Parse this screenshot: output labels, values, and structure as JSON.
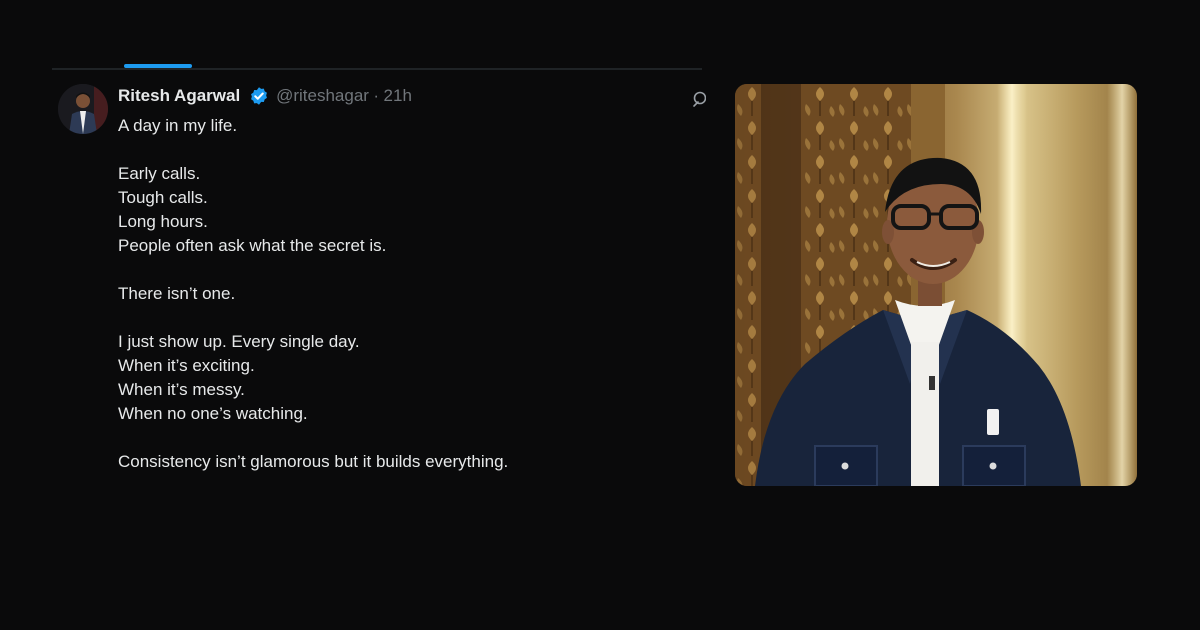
{
  "tweet": {
    "author_name": "Ritesh Agarwal",
    "handle": "@riteshagar",
    "separator": "·",
    "timestamp": "21h",
    "verified": true,
    "lines": [
      "A day in my life.",
      "",
      "Early calls.",
      "Tough calls.",
      "Long hours.",
      "People often ask what the secret is.",
      "",
      "There isn’t one.",
      "",
      "I just show up. Every single day.",
      "When it’s exciting.",
      "When it’s messy.",
      "When no one’s watching.",
      "",
      "Consistency isn’t glamorous but it builds everything."
    ]
  },
  "icons": {
    "verified": "verified-badge-icon",
    "grok": "grok-icon"
  },
  "colors": {
    "background": "#0a0a0b",
    "accent": "#1d9bf0",
    "text_primary": "#e7e9ea",
    "text_secondary": "#71767b"
  }
}
